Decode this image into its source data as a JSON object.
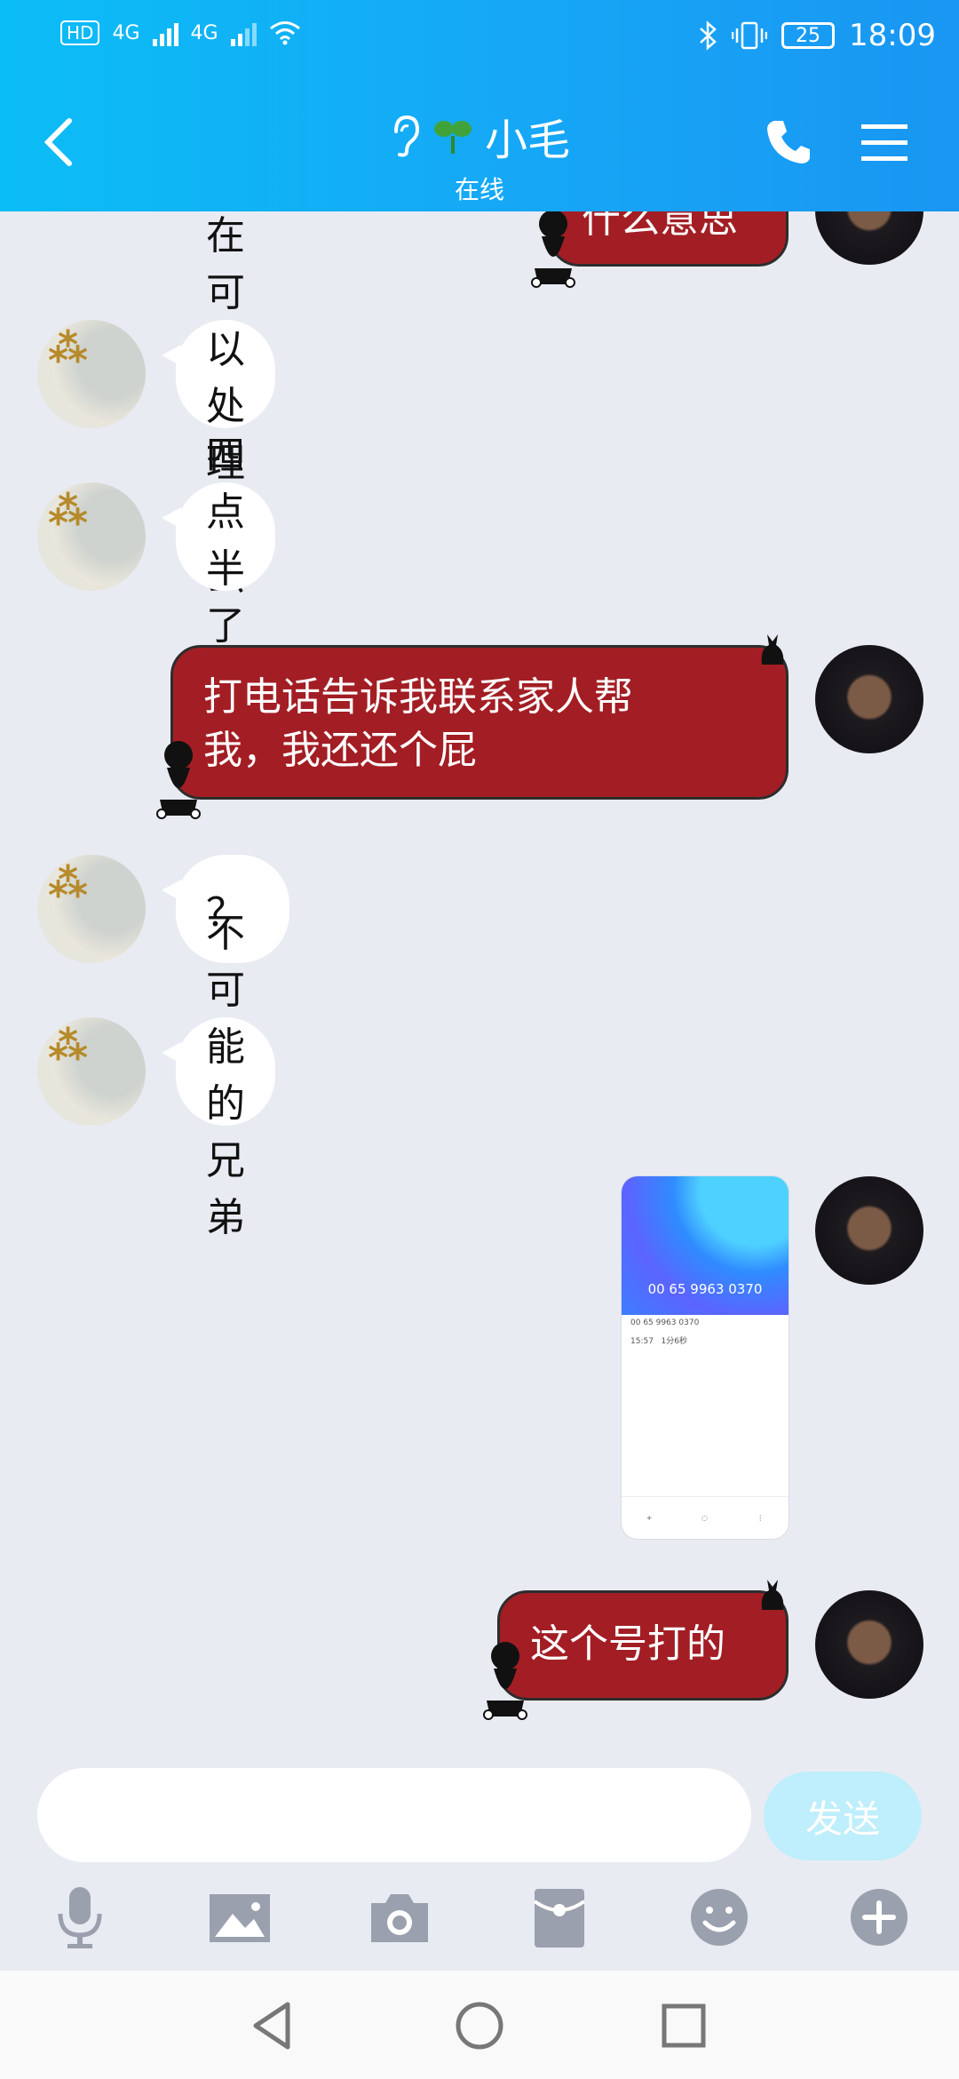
{
  "status_bar": {
    "hd": "HD",
    "sim1": "4G",
    "sim2": "4G",
    "battery": "25",
    "time": "18:09"
  },
  "header": {
    "title": "小毛",
    "subtitle": "在线"
  },
  "messages": [
    {
      "side": "right",
      "text": "什么意思"
    },
    {
      "side": "left",
      "text": "现在可以处理了么"
    },
    {
      "side": "left",
      "text": "四点半了"
    },
    {
      "side": "right",
      "line1": "打电话告诉我联系家人帮",
      "line2": "我，我还还个屁"
    },
    {
      "side": "left",
      "text": "？"
    },
    {
      "side": "left",
      "text": "不可能的兄弟"
    },
    {
      "side": "right",
      "type": "image"
    },
    {
      "side": "right",
      "text": "这个号打的"
    }
  ],
  "image_preview": {
    "number": "00 65 9963 0370",
    "entry_number": "00 65 9963 0370",
    "entry_time": "15:57",
    "entry_duration": "1分6秒"
  },
  "composer": {
    "placeholder": "",
    "send_label": "发送"
  },
  "toolbar_icons": [
    "microphone-icon",
    "image-icon",
    "camera-icon",
    "red-packet-icon",
    "emoji-icon",
    "plus-icon"
  ],
  "colors": {
    "header_start": "#0bbdf6",
    "header_end": "#1996f2",
    "red_bubble": "#a21e24",
    "background": "#e9ebf2",
    "send_button": "#bfeefc"
  }
}
